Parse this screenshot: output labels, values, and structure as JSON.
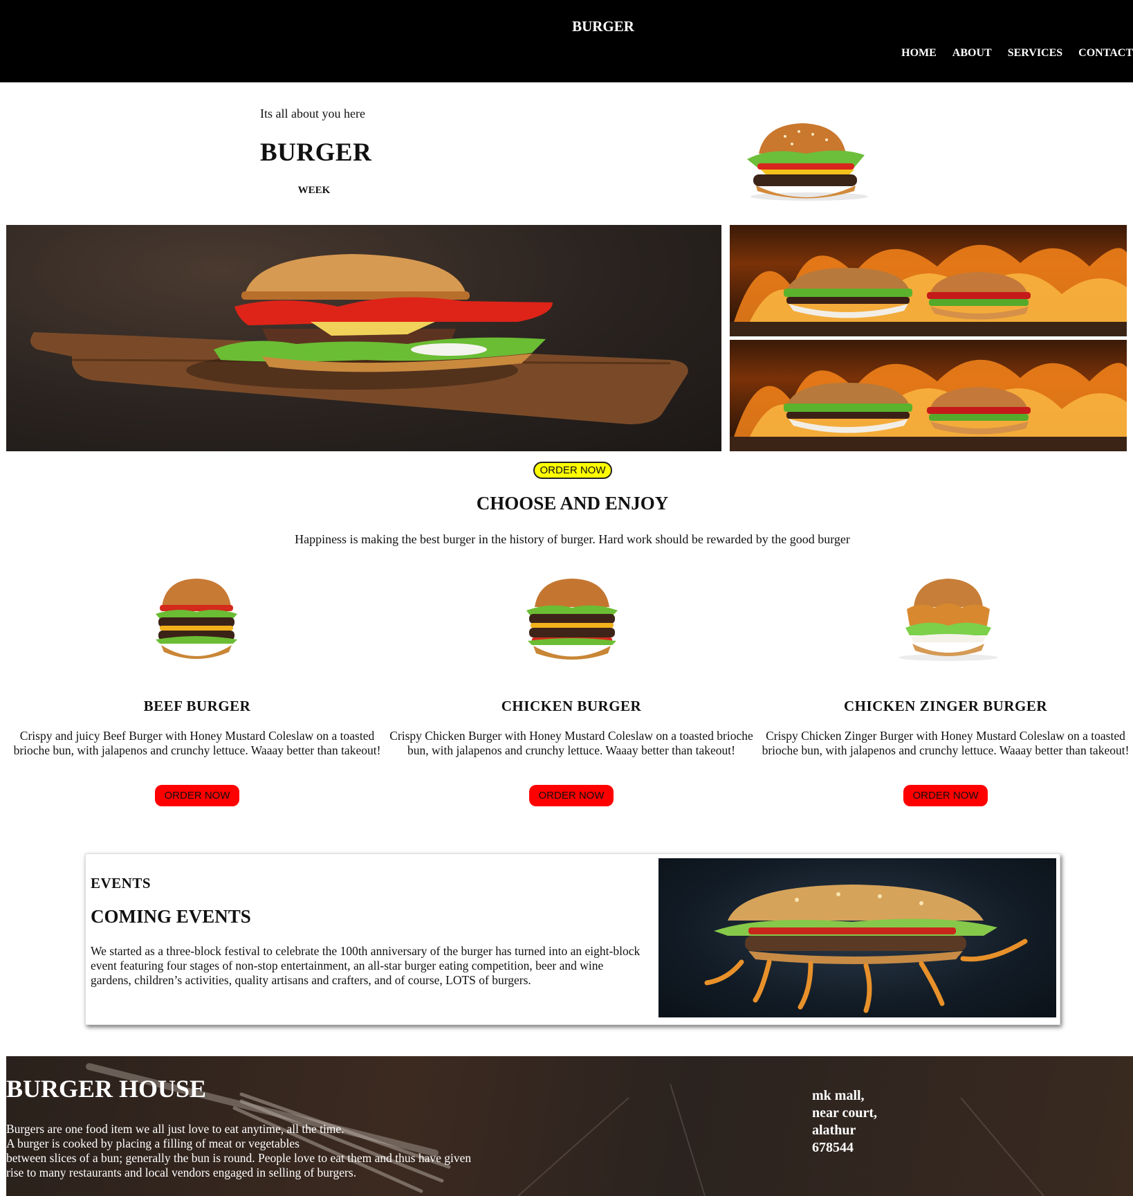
{
  "header": {
    "brand": "BURGER",
    "nav": [
      {
        "label": "HOME"
      },
      {
        "label": "ABOUT"
      },
      {
        "label": "SERVICES"
      },
      {
        "label": "CONTACT"
      }
    ]
  },
  "hero": {
    "tagline": "Its all about you here",
    "title": "BURGER",
    "subtitle": "WEEK",
    "order_label": "ORDER NOW"
  },
  "menu": {
    "title": "CHOOSE AND ENJOY",
    "description": "Happiness is making the best burger in the history of burger. Hard work should be rewarded by the good burger",
    "items": [
      {
        "name": "BEEF BURGER",
        "description": "Crispy and juicy Beef Burger with Honey Mustard Coleslaw on a toasted brioche bun, with jalapenos and crunchy lettuce. Waaay better than takeout!",
        "button": "ORDER NOW"
      },
      {
        "name": "CHICKEN BURGER",
        "description": "Crispy Chicken Burger with Honey Mustard Coleslaw on a toasted brioche bun, with jalapenos and crunchy lettuce. Waaay better than takeout!",
        "button": "ORDER NOW"
      },
      {
        "name": "CHICKEN ZINGER BURGER",
        "description": "Crispy Chicken Zinger Burger with Honey Mustard Coleslaw on a toasted brioche bun, with jalapenos and crunchy lettuce. Waaay better than takeout!",
        "button": "ORDER NOW"
      }
    ]
  },
  "events": {
    "kicker": "EVENTS",
    "title": "COMING EVENTS",
    "text": "We started as a three-block festival to celebrate the 100th anniversary of the burger has turned into an eight-block event featuring four stages of non-stop entertainment, an all-star burger eating competition, beer and wine gardens, children’s activities, quality artisans and crafters, and of course, LOTS of burgers."
  },
  "footer": {
    "title": "BURGER HOUSE",
    "text_lines": [
      "Burgers are one food item we all just love to eat anytime, all the time.",
      "A burger is cooked by placing a filling of meat or vegetables",
      "between slices of a bun; generally the bun is round. People love to eat them and thus have given",
      "rise to many restaurants and local vendors engaged in selling of burgers."
    ],
    "address_lines": [
      "mk mall,",
      "near court,",
      "alathur",
      "678544"
    ]
  },
  "colors": {
    "header_bg": "#000000",
    "order_yellow": "#ffff00",
    "order_red": "#ff0000"
  }
}
